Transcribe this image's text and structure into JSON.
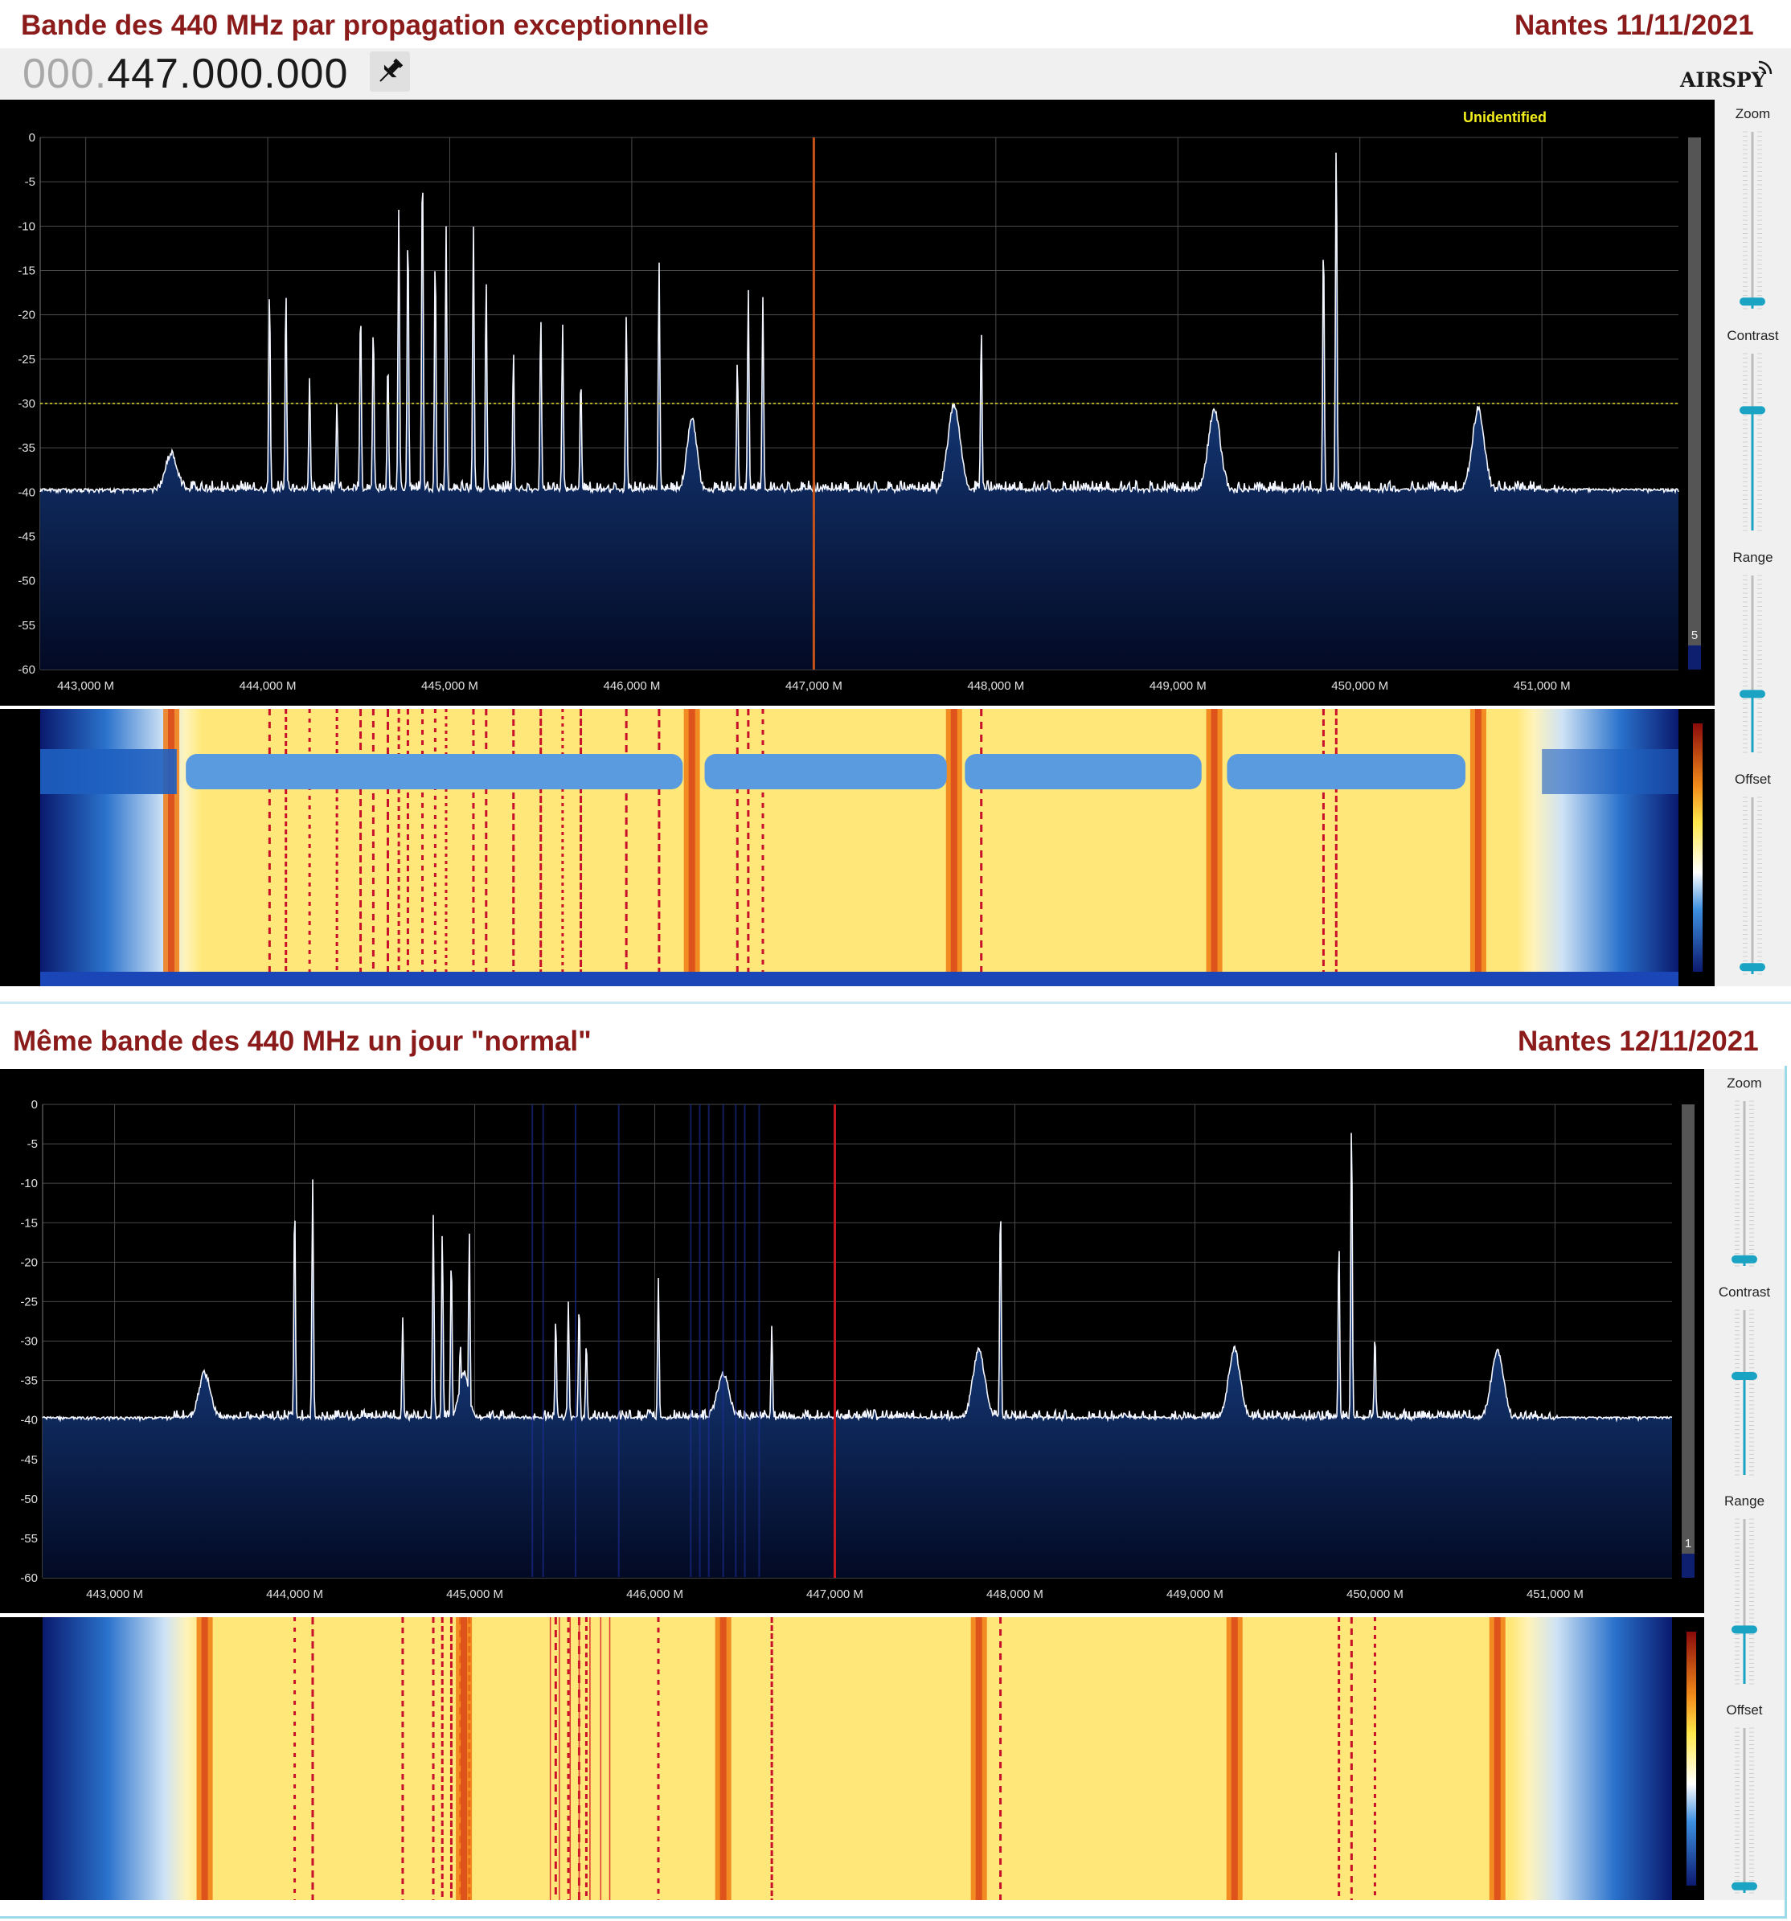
{
  "top": {
    "caption_left": "Bande des 440 MHz par propagation exceptionnelle",
    "caption_right": "Nantes 11/11/2021",
    "frequency_dim": "000.",
    "frequency_main": "447.000.000",
    "logo_text": "AIRSPY",
    "pin_icon": "pin-icon",
    "label_unidentified": "Unidentified",
    "controls": [
      "Zoom",
      "Contrast",
      "Range",
      "Offset"
    ],
    "slider_levels": [
      0.04,
      0.68,
      0.33,
      0.04
    ],
    "scale_corner_value": "5"
  },
  "bottom": {
    "caption_left": "Même bande des 440 MHz un jour \"normal\"",
    "caption_right": "Nantes 12/11/2021",
    "controls": [
      "Zoom",
      "Contrast",
      "Range",
      "Offset"
    ],
    "slider_levels": [
      0.04,
      0.6,
      0.33,
      0.04
    ],
    "scale_corner_value": "1"
  },
  "chart_data": [
    {
      "type": "area",
      "title": "",
      "xlabel": "",
      "ylabel": "",
      "x_ticks": [
        "443,000 M",
        "444,000 M",
        "445,000 M",
        "446,000 M",
        "447,000 M",
        "448,000 M",
        "449,000 M",
        "450,000 M",
        "451,000 M"
      ],
      "y_ticks": [
        "0",
        "-5",
        "-10",
        "-15",
        "-20",
        "-25",
        "-30",
        "-35",
        "-40",
        "-45",
        "-50",
        "-55",
        "-60"
      ],
      "xlim": [
        442.75,
        451.75
      ],
      "ylim": [
        -60,
        0
      ],
      "grid": true,
      "center_marker_mhz": 447.0,
      "squelch_level_db": -30,
      "noise_floor_db": -40,
      "spectrum_peaks": [
        {
          "x": 443.47,
          "y": -35.5,
          "w": 0.05
        },
        {
          "x": 444.01,
          "y": -17,
          "w": 0.006
        },
        {
          "x": 444.1,
          "y": -17,
          "w": 0.006
        },
        {
          "x": 444.23,
          "y": -27,
          "w": 0.006
        },
        {
          "x": 444.38,
          "y": -30,
          "w": 0.006
        },
        {
          "x": 444.51,
          "y": -19,
          "w": 0.006
        },
        {
          "x": 444.58,
          "y": -21,
          "w": 0.006
        },
        {
          "x": 444.66,
          "y": -25,
          "w": 0.006
        },
        {
          "x": 444.72,
          "y": -8,
          "w": 0.006
        },
        {
          "x": 444.77,
          "y": -10,
          "w": 0.006
        },
        {
          "x": 444.85,
          "y": -2,
          "w": 0.006
        },
        {
          "x": 444.92,
          "y": -13,
          "w": 0.006
        },
        {
          "x": 444.98,
          "y": -10,
          "w": 0.006
        },
        {
          "x": 445.13,
          "y": -10,
          "w": 0.006
        },
        {
          "x": 445.2,
          "y": -16,
          "w": 0.006
        },
        {
          "x": 445.35,
          "y": -24,
          "w": 0.006
        },
        {
          "x": 445.5,
          "y": -20,
          "w": 0.006
        },
        {
          "x": 445.62,
          "y": -21,
          "w": 0.006
        },
        {
          "x": 445.72,
          "y": -27,
          "w": 0.006
        },
        {
          "x": 445.97,
          "y": -20,
          "w": 0.006
        },
        {
          "x": 446.15,
          "y": -14,
          "w": 0.006
        },
        {
          "x": 446.33,
          "y": -31.5,
          "w": 0.04
        },
        {
          "x": 446.58,
          "y": -25,
          "w": 0.006
        },
        {
          "x": 446.64,
          "y": -17,
          "w": 0.006
        },
        {
          "x": 446.72,
          "y": -18,
          "w": 0.006
        },
        {
          "x": 447.77,
          "y": -30,
          "w": 0.05
        },
        {
          "x": 447.92,
          "y": -21.5,
          "w": 0.006
        },
        {
          "x": 449.2,
          "y": -30.5,
          "w": 0.05
        },
        {
          "x": 449.8,
          "y": -11,
          "w": 0.006
        },
        {
          "x": 449.87,
          "y": 0,
          "w": 0.006
        },
        {
          "x": 450.65,
          "y": -30.5,
          "w": 0.05
        }
      ]
    },
    {
      "type": "area",
      "title": "",
      "xlabel": "",
      "ylabel": "",
      "x_ticks": [
        "443,000 M",
        "444,000 M",
        "445,000 M",
        "446,000 M",
        "447,000 M",
        "448,000 M",
        "449,000 M",
        "450,000 M",
        "451,000 M"
      ],
      "y_ticks": [
        "0",
        "-5",
        "-10",
        "-15",
        "-20",
        "-25",
        "-30",
        "-35",
        "-40",
        "-45",
        "-50",
        "-55",
        "-60"
      ],
      "xlim": [
        442.6,
        451.65
      ],
      "ylim": [
        -60,
        0
      ],
      "grid": true,
      "center_marker_mhz": 447.0,
      "noise_floor_db": -40,
      "spectrum_peaks": [
        {
          "x": 443.5,
          "y": -34,
          "w": 0.05
        },
        {
          "x": 444.0,
          "y": -12,
          "w": 0.006
        },
        {
          "x": 444.1,
          "y": -9.5,
          "w": 0.006
        },
        {
          "x": 444.6,
          "y": -27,
          "w": 0.006
        },
        {
          "x": 444.77,
          "y": -14,
          "w": 0.006
        },
        {
          "x": 444.82,
          "y": -16,
          "w": 0.006
        },
        {
          "x": 444.87,
          "y": -19,
          "w": 0.006
        },
        {
          "x": 444.92,
          "y": -30,
          "w": 0.006
        },
        {
          "x": 444.97,
          "y": -16,
          "w": 0.006
        },
        {
          "x": 444.94,
          "y": -34,
          "w": 0.04
        },
        {
          "x": 445.45,
          "y": -27,
          "w": 0.006
        },
        {
          "x": 445.52,
          "y": -25,
          "w": 0.006
        },
        {
          "x": 445.58,
          "y": -25,
          "w": 0.006
        },
        {
          "x": 445.62,
          "y": -30,
          "w": 0.006
        },
        {
          "x": 446.02,
          "y": -22,
          "w": 0.006
        },
        {
          "x": 446.38,
          "y": -34,
          "w": 0.05
        },
        {
          "x": 446.65,
          "y": -28,
          "w": 0.006
        },
        {
          "x": 447.8,
          "y": -31,
          "w": 0.05
        },
        {
          "x": 447.92,
          "y": -12,
          "w": 0.006
        },
        {
          "x": 449.22,
          "y": -31,
          "w": 0.05
        },
        {
          "x": 449.8,
          "y": -17,
          "w": 0.006
        },
        {
          "x": 449.87,
          "y": -1.5,
          "w": 0.006
        },
        {
          "x": 450.0,
          "y": -29,
          "w": 0.006
        },
        {
          "x": 450.68,
          "y": -31,
          "w": 0.05
        }
      ]
    }
  ]
}
